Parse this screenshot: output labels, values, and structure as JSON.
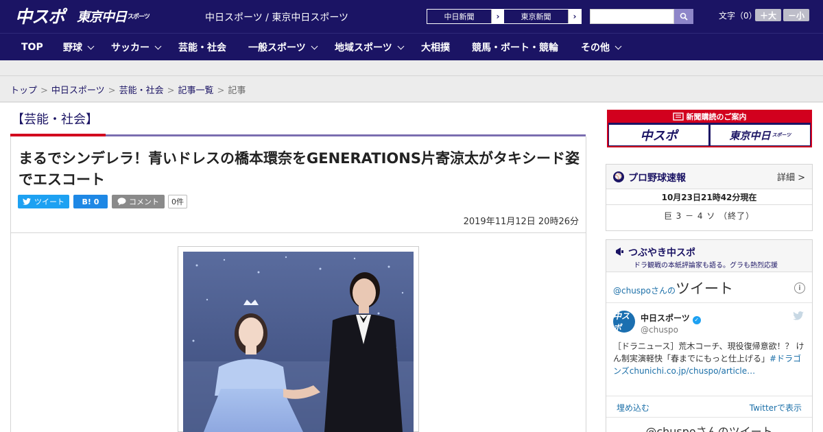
{
  "header": {
    "logo_chuspo": "中スポ",
    "logo_tokyo": "東京中日",
    "logo_tokyo_small": "スポーツ",
    "site_title": "中日スポーツ / 東京中日スポーツ",
    "link_chunichi": "中日新聞",
    "link_tokyo": "東京新聞",
    "search_placeholder": "",
    "font_size_label": "文字（0）",
    "font_larger": "＋大",
    "font_smaller": "－小"
  },
  "nav": {
    "items": [
      {
        "label": "TOP"
      },
      {
        "label": "野球"
      },
      {
        "label": "サッカー"
      },
      {
        "label": "芸能・社会"
      },
      {
        "label": "一般スポーツ"
      },
      {
        "label": "地域スポーツ"
      },
      {
        "label": "大相撲"
      },
      {
        "label": "競馬・ボート・競輪"
      },
      {
        "label": "その他"
      }
    ]
  },
  "breadcrumb": {
    "items": [
      "トップ",
      "中日スポーツ",
      "芸能・社会",
      "記事一覧"
    ],
    "current": "記事",
    "separator": ">"
  },
  "article": {
    "section": "【芸能・社会】",
    "title": "まるでシンデレラ！青いドレスの橋本環奈をGENERATIONS片寄涼太がタキシード姿でエスコート",
    "tweet_label": "ツイート",
    "hatena_label": "B! 0",
    "comment_label": "コメント",
    "comment_count": "0件",
    "date": "2019年11月12日 20時26分"
  },
  "sidebar": {
    "ad_title": "新聞購読のご案内",
    "ad_chuspo": "中スポ",
    "ad_tokyo": "東京中日",
    "ad_tokyo_small": "スポーツ",
    "baseball": {
      "title": "プロ野球速報",
      "detail": "詳細 >",
      "time": "10月23日21時42分現在",
      "score": "巨 3 － 4 ソ （終了）"
    },
    "tsubuyaki": {
      "title": "つぶやき中スポ",
      "subtitle": "ドラ観戦の本紙評論家も語る。グラも熱烈応援",
      "tweets_prefix": "@chuspoさんの",
      "tweets_big": "ツイート",
      "account_name": "中日スポーツ",
      "account_handle": "@chuspo",
      "tweet_text": "［ドラニュース］荒木コーチ、現役復帰意欲！？ けん制実演軽快「春までにもっと仕上げる」",
      "tweet_link": "#ドラゴンズchunichi.co.jp/chuspo/article…",
      "embed": "埋め込む",
      "view_on_twitter": "Twitterで表示",
      "more": "@chuspoさんのツイート"
    }
  },
  "colors": {
    "brand_navy": "#1b1464",
    "accent_red": "#d2001e",
    "twitter_blue": "#1da1f2"
  }
}
